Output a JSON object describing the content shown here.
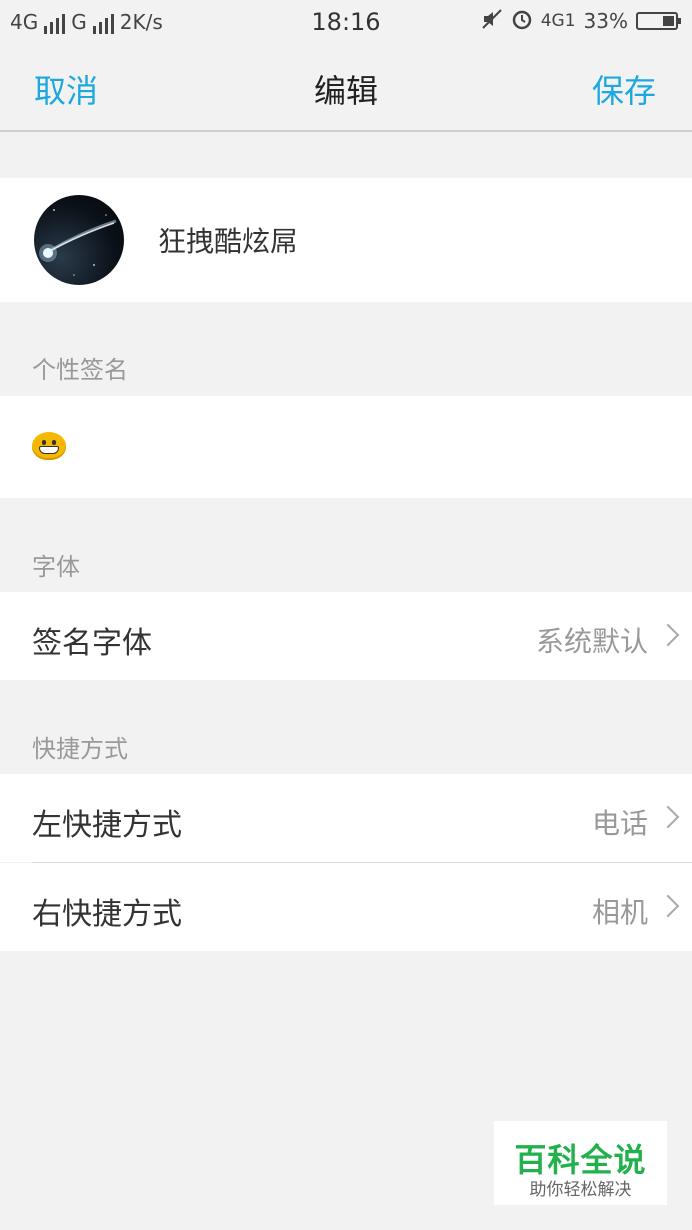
{
  "status_bar": {
    "network1": "4G",
    "network2": "G",
    "speed": "2K/s",
    "time": "18:16",
    "network3": "4G1",
    "battery_percent": "33%",
    "battery_level": 0.33,
    "icons": [
      "mute-icon",
      "alarm-icon"
    ]
  },
  "navbar": {
    "cancel_label": "取消",
    "title": "编辑",
    "save_label": "保存",
    "accent_color": "#1ea8e0"
  },
  "profile": {
    "name": "狂拽酷炫屌",
    "avatar_icon": "comet-avatar"
  },
  "sections": {
    "signature_label": "个性签名",
    "signature_emoji_icon": "grin-emoji-icon",
    "font_label": "字体",
    "shortcut_label": "快捷方式"
  },
  "rows": {
    "signature_font": {
      "title": "签名字体",
      "value": "系统默认"
    },
    "left_shortcut": {
      "title": "左快捷方式",
      "value": "电话"
    },
    "right_shortcut": {
      "title": "右快捷方式",
      "value": "相机"
    }
  },
  "watermark": {
    "main": "百科全说",
    "sub": "助你轻松解决"
  }
}
